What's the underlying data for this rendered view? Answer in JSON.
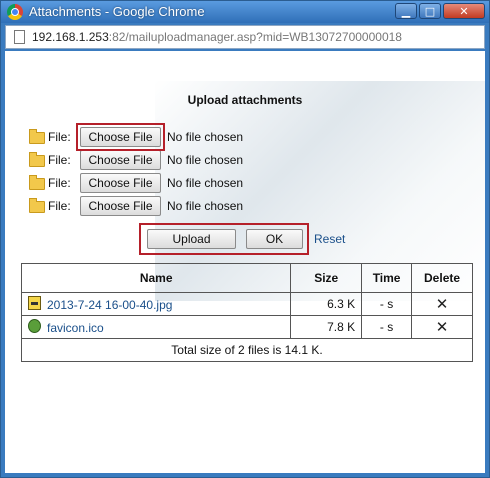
{
  "window": {
    "title": "Attachments - Google Chrome",
    "min_glyph": "▁",
    "max_glyph": "□",
    "close_glyph": "✕"
  },
  "address": {
    "host": "192.168.1.253",
    "path": ":82/mailuploadmanager.asp?mid=WB13072700000018"
  },
  "dialog": {
    "heading": "Upload attachments",
    "file_rows": [
      {
        "label": "File:",
        "button": "Choose File",
        "status": "No file chosen"
      },
      {
        "label": "File:",
        "button": "Choose File",
        "status": "No file chosen"
      },
      {
        "label": "File:",
        "button": "Choose File",
        "status": "No file chosen"
      },
      {
        "label": "File:",
        "button": "Choose File",
        "status": "No file chosen"
      }
    ],
    "upload_label": "Upload",
    "ok_label": "OK",
    "reset_label": "Reset"
  },
  "table": {
    "headers": {
      "name": "Name",
      "size": "Size",
      "time": "Time",
      "delete": "Delete"
    },
    "rows": [
      {
        "name": "2013-7-24 16-00-40.jpg",
        "size": "6.3 K",
        "time": "- s",
        "delete": "✕",
        "icon": "jpg-file-icon"
      },
      {
        "name": "favicon.ico",
        "size": "7.8 K",
        "time": "- s",
        "delete": "✕",
        "icon": "ico-file-icon"
      }
    ],
    "summary": "Total size of 2 files is 14.1 K."
  },
  "colors": {
    "highlight": "#b5202a",
    "link": "#1a4f8a",
    "titlebar": "#2f6fb7"
  }
}
